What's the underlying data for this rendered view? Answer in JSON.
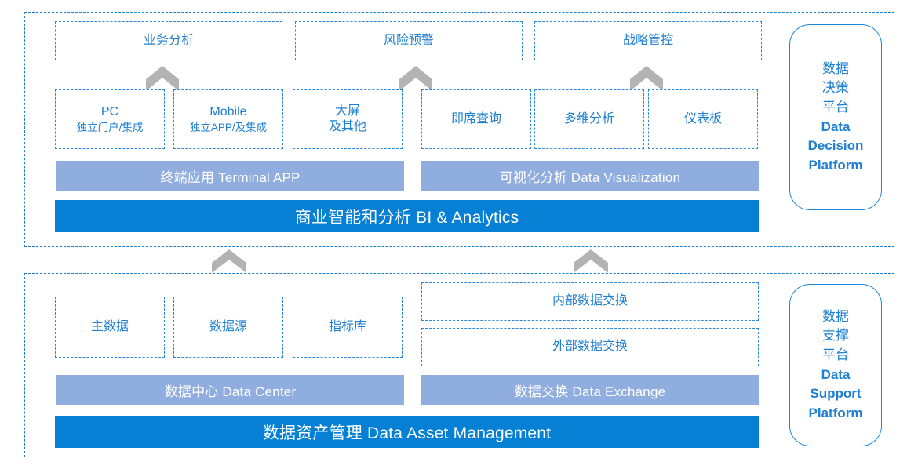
{
  "colors": {
    "accent_blue": "#0580d4",
    "light_bar": "#8fadde",
    "outline_blue": "#2a86d8",
    "text_blue": "#1f7fd0",
    "arrow_gray": "#b3b3b3"
  },
  "top_section": {
    "top_row": [
      {
        "label": "业务分析"
      },
      {
        "label": "风险预警"
      },
      {
        "label": "战略管控"
      }
    ],
    "mid_row_left": [
      {
        "title": "PC",
        "subtitle": "独立门户/集成"
      },
      {
        "title": "Mobile",
        "subtitle": "独立APP/及集成"
      },
      {
        "title": "大屏",
        "subtitle": "及其他"
      }
    ],
    "mid_row_right": [
      {
        "title": "即席查询",
        "subtitle": ""
      },
      {
        "title": "多维分析",
        "subtitle": ""
      },
      {
        "title": "仪表板",
        "subtitle": ""
      }
    ],
    "light_bars": [
      {
        "label": "终端应用 Terminal APP"
      },
      {
        "label": "可视化分析 Data Visualization"
      }
    ],
    "blue_bar": {
      "label": "商业智能和分析 BI & Analytics"
    },
    "panel": {
      "line1": "数据",
      "line2": "决策",
      "line3": "平台",
      "line4": "Data",
      "line5": "Decision",
      "line6": "Platform"
    }
  },
  "bottom_section": {
    "left_boxes": [
      {
        "label": "主数据"
      },
      {
        "label": "数据源"
      },
      {
        "label": "指标库"
      }
    ],
    "right_boxes": [
      {
        "label": "内部数据交换"
      },
      {
        "label": "外部数据交换"
      }
    ],
    "light_bars": [
      {
        "label": "数据中心 Data Center"
      },
      {
        "label": "数据交换 Data  Exchange"
      }
    ],
    "blue_bar": {
      "label": "数据资产管理 Data Asset Management"
    },
    "panel": {
      "line1": "数据",
      "line2": "支撑",
      "line3": "平台",
      "line4": "Data",
      "line5": "Support",
      "line6": "Platform"
    }
  }
}
